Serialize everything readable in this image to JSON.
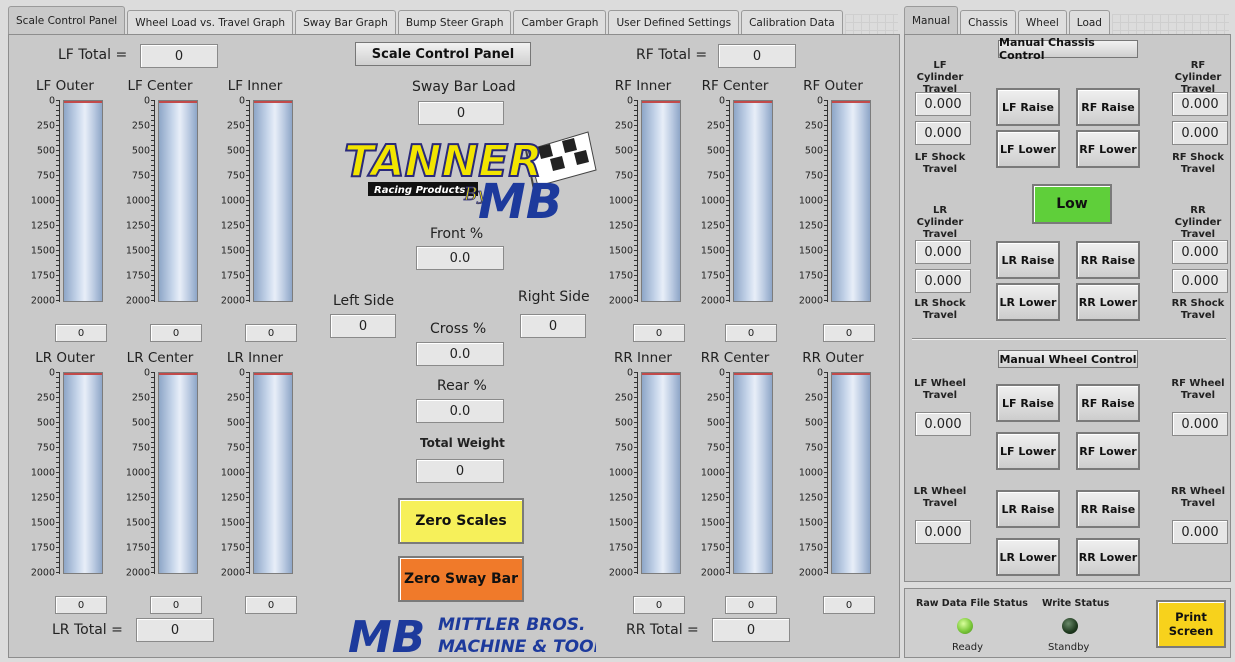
{
  "tabs_left": [
    "Scale Control Panel",
    "Wheel Load vs. Travel Graph",
    "Sway Bar Graph",
    "Bump Steer Graph",
    "Camber Graph",
    "User Defined Settings",
    "Calibration Data"
  ],
  "tabs_right": [
    "Manual",
    "Chassis",
    "Wheel",
    "Load"
  ],
  "scale_ticks": [
    "0",
    "250",
    "500",
    "750",
    "1000",
    "1250",
    "1500",
    "1750",
    "2000"
  ],
  "totals": {
    "lf_label": "LF Total =",
    "lf_value": "0",
    "rf_label": "RF Total =",
    "rf_value": "0",
    "lr_label": "LR Total =",
    "lr_value": "0",
    "rr_label": "RR Total =",
    "rr_value": "0"
  },
  "gauges": {
    "lf_outer": {
      "label": "LF Outer",
      "value": "0"
    },
    "lf_center": {
      "label": "LF Center",
      "value": "0"
    },
    "lf_inner": {
      "label": "LF Inner",
      "value": "0"
    },
    "rf_inner": {
      "label": "RF Inner",
      "value": "0"
    },
    "rf_center": {
      "label": "RF Center",
      "value": "0"
    },
    "rf_outer": {
      "label": "RF Outer",
      "value": "0"
    },
    "lr_outer": {
      "label": "LR Outer",
      "value": "0"
    },
    "lr_center": {
      "label": "LR Center",
      "value": "0"
    },
    "lr_inner": {
      "label": "LR Inner",
      "value": "0"
    },
    "rr_inner": {
      "label": "RR Inner",
      "value": "0"
    },
    "rr_center": {
      "label": "RR Center",
      "value": "0"
    },
    "rr_outer": {
      "label": "RR Outer",
      "value": "0"
    }
  },
  "center": {
    "title": "Scale Control Panel",
    "sway_label": "Sway Bar Load",
    "sway_value": "0",
    "front_label": "Front %",
    "front_value": "0.0",
    "left_label": "Left Side",
    "left_value": "0",
    "right_label": "Right Side",
    "right_value": "0",
    "cross_label": "Cross %",
    "cross_value": "0.0",
    "rear_label": "Rear %",
    "rear_value": "0.0",
    "total_label": "Total Weight",
    "total_value": "0",
    "zero_scales": "Zero Scales",
    "zero_sway": "Zero Sway Bar"
  },
  "logo": {
    "tanner": "TANNER",
    "racing": "Racing Products",
    "by": "By",
    "mb": "MB",
    "mittler_line1": "MITTLER BROS.",
    "mittler_line2": "MACHINE & TOOL"
  },
  "manual": {
    "chassis_header": "Manual Chassis Control",
    "lf_cyl_label": "LF Cylinder Travel",
    "lf_cyl_value": "0.000",
    "rf_cyl_label": "RF Cylinder Travel",
    "rf_cyl_value": "0.000",
    "lf_shock_label": "LF Shock Travel",
    "lf_shock_value": "0.000",
    "rf_shock_label": "RF Shock Travel",
    "rf_shock_value": "0.000",
    "lr_cyl_label": "LR Cylinder Travel",
    "lr_cyl_value": "0.000",
    "rr_cyl_label": "RR Cylinder Travel",
    "rr_cyl_value": "0.000",
    "lr_shock_label": "LR Shock Travel",
    "lr_shock_value": "0.000",
    "rr_shock_label": "RR Shock Travel",
    "rr_shock_value": "0.000",
    "lf_raise": "LF Raise",
    "rf_raise": "RF Raise",
    "lf_lower": "LF Lower",
    "rf_lower": "RF Lower",
    "lr_raise": "LR Raise",
    "rr_raise": "RR Raise",
    "lr_lower": "LR Lower",
    "rr_lower": "RR Lower",
    "low_button": "Low",
    "wheel_header": "Manual Wheel Control",
    "lf_wheel_label": "LF Wheel Travel",
    "lf_wheel_value": "0.000",
    "rf_wheel_label": "RF Wheel Travel",
    "rf_wheel_value": "0.000",
    "lr_wheel_label": "LR Wheel Travel",
    "lr_wheel_value": "0.000",
    "rr_wheel_label": "RR Wheel Travel",
    "rr_wheel_value": "0.000",
    "w_lf_raise": "LF Raise",
    "w_rf_raise": "RF Raise",
    "w_lf_lower": "LF Lower",
    "w_rf_lower": "RF Lower",
    "w_lr_raise": "LR Raise",
    "w_rr_raise": "RR Raise",
    "w_lr_lower": "LR Lower",
    "w_rr_lower": "RR Lower"
  },
  "status": {
    "raw_label": "Raw Data File Status",
    "raw_value": "Ready",
    "write_label": "Write Status",
    "write_value": "Standby",
    "print_button": "Print Screen"
  },
  "colors": {
    "yellow": "#f6f05a",
    "orange": "#f07a2a",
    "green": "#5fcf3a",
    "print_yellow": "#f7d21c"
  }
}
